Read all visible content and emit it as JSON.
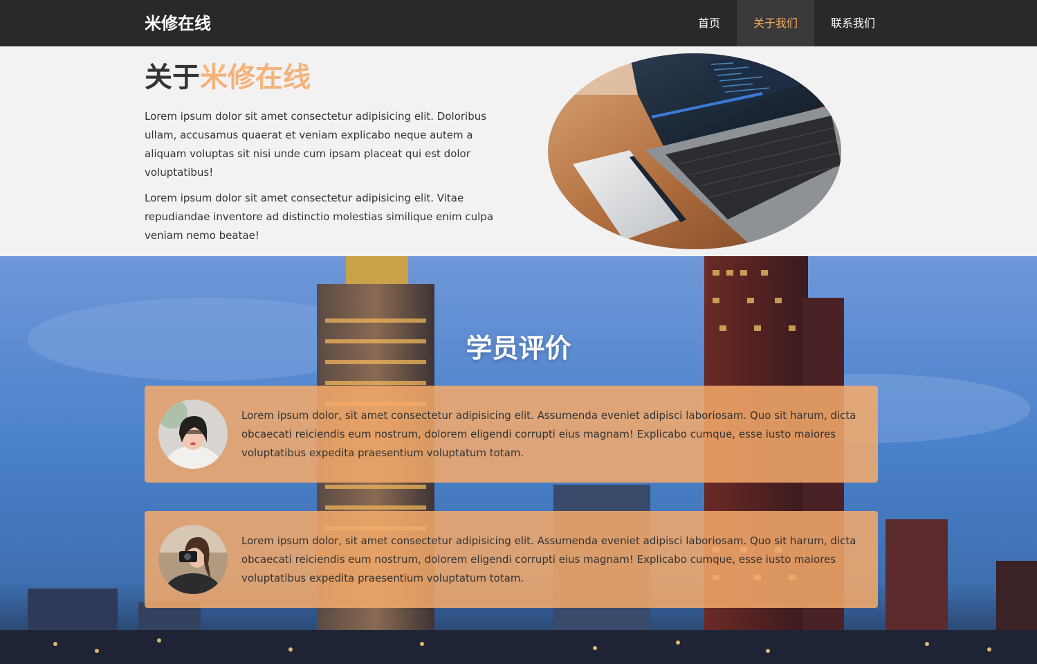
{
  "header": {
    "brand": "米修在线",
    "nav": [
      {
        "label": "首页",
        "active": false
      },
      {
        "label": "关于我们",
        "active": true
      },
      {
        "label": "联系我们",
        "active": false
      }
    ]
  },
  "about": {
    "title_prefix": "关于",
    "title_accent": "米修在线",
    "paragraphs": [
      "Lorem ipsum dolor sit amet consectetur adipisicing elit. Doloribus ullam, accusamus quaerat et veniam explicabo neque autem a aliquam voluptas sit nisi unde cum ipsam placeat qui est dolor voluptatibus!",
      "Lorem ipsum dolor sit amet consectetur adipisicing elit. Vitae repudiandae inventore ad distinctio molestias similique enim culpa veniam nemo beatae!"
    ]
  },
  "testimonials": {
    "title": "学员评价",
    "items": [
      {
        "text": "Lorem ipsum dolor, sit amet consectetur adipisicing elit. Assumenda eveniet adipisci laboriosam. Quo sit harum, dicta obcaecati reiciendis eum nostrum, dolorem eligendi corrupti eius magnam! Explicabo cumque, esse iusto maiores voluptatibus expedita praesentium voluptatum totam."
      },
      {
        "text": "Lorem ipsum dolor, sit amet consectetur adipisicing elit. Assumenda eveniet adipisci laboriosam. Quo sit harum, dicta obcaecati reiciendis eum nostrum, dolorem eligendi corrupti eius magnam! Explicabo cumque, esse iusto maiores voluptatibus expedita praesentium voluptatum totam."
      }
    ]
  },
  "colors": {
    "navbar": "#292929",
    "accent": "#f4a964",
    "card": "#f4aa6a",
    "about_bg": "#f2f2f2",
    "text": "#333333"
  }
}
